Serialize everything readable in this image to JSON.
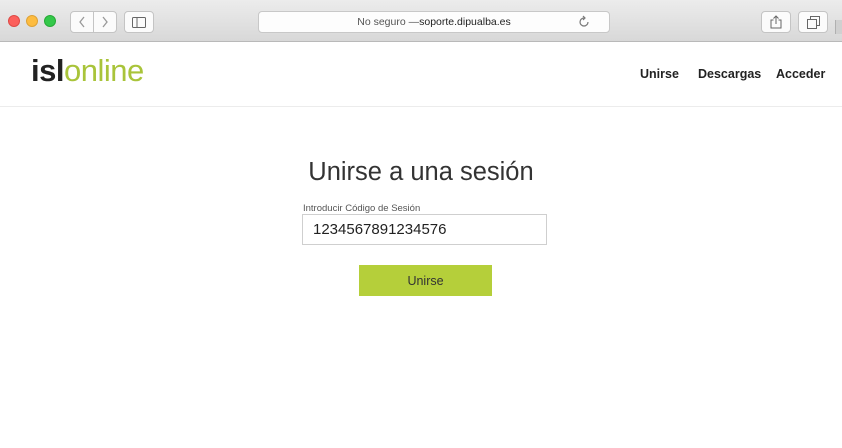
{
  "browser": {
    "address_prefix": "No seguro — ",
    "address_host": "soporte.dipualba.es"
  },
  "header": {
    "logo_bold": "isl",
    "logo_light": "online",
    "nav": [
      "Unirse",
      "Descargas",
      "Acceder"
    ]
  },
  "main": {
    "title": "Unirse a una sesión",
    "field_label": "Introducir Código de Sesión",
    "code_value": "1234567891234576",
    "join_label": "Unirse"
  },
  "colors": {
    "brand_green": "#a9c43a",
    "button_green": "#b5cf3a"
  },
  "icons": [
    "back-icon",
    "forward-icon",
    "sidebar-icon",
    "reload-icon",
    "share-icon",
    "tabs-icon"
  ]
}
